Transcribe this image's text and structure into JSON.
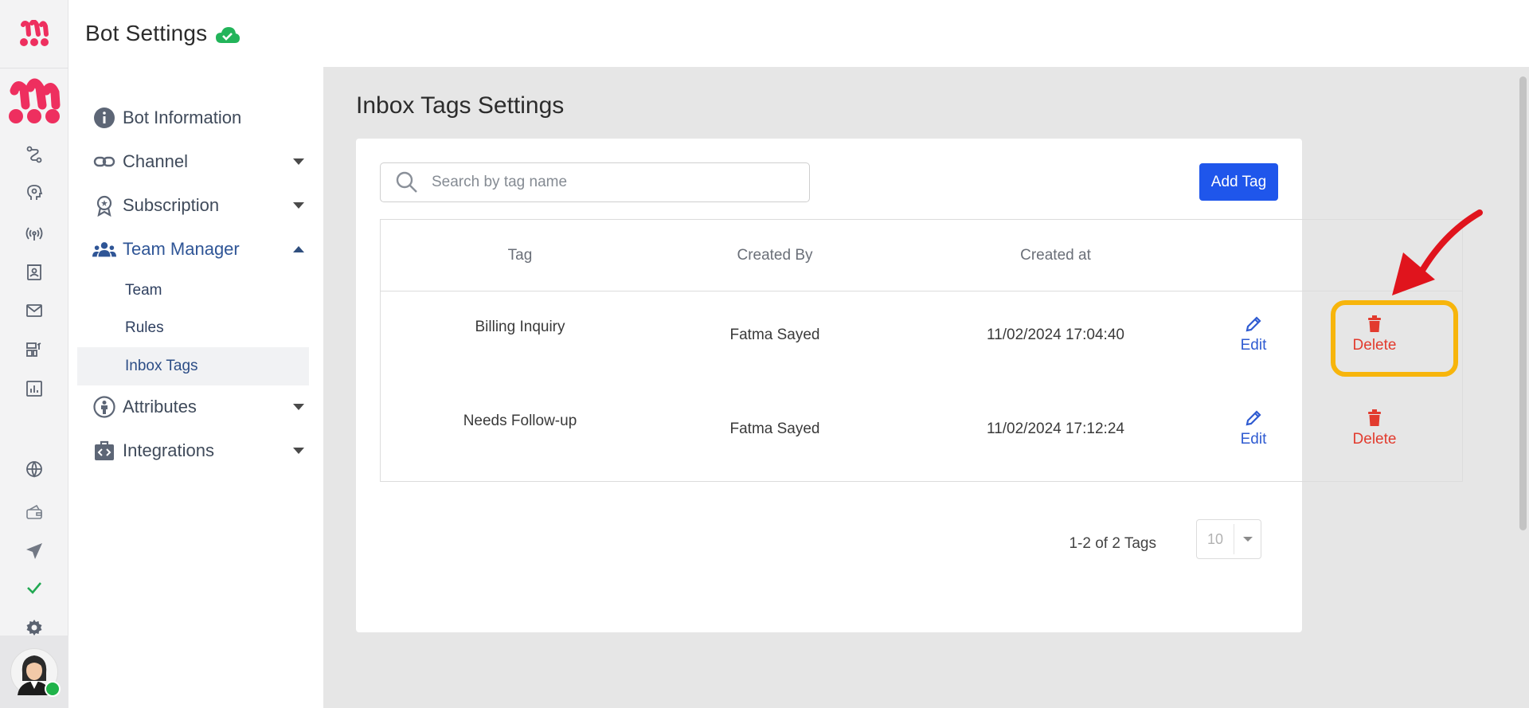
{
  "app": {
    "brand_color": "#ee2f5f",
    "accent": "#1f56eb"
  },
  "header": {
    "title": "Bot Settings",
    "status_icon": "cloud-check-icon"
  },
  "rail": {
    "icons": [
      "flow-icon",
      "ai-brain-icon",
      "broadcast-icon",
      "contacts-icon",
      "mail-icon",
      "widgets-icon",
      "analytics-icon",
      "globe-icon",
      "wallet-icon",
      "send-icon",
      "check-icon",
      "gear-icon"
    ]
  },
  "settings_nav": {
    "items": [
      {
        "label": "Bot Information",
        "icon": "info-icon"
      },
      {
        "label": "Channel",
        "icon": "link-icon"
      },
      {
        "label": "Subscription",
        "icon": "badge-icon"
      },
      {
        "label": "Team Manager",
        "icon": "team-icon"
      },
      {
        "label": "Attributes",
        "icon": "person-icon"
      },
      {
        "label": "Integrations",
        "icon": "code-bag-icon"
      }
    ],
    "team_sub": [
      {
        "label": "Team"
      },
      {
        "label": "Rules"
      },
      {
        "label": "Inbox Tags"
      }
    ]
  },
  "main": {
    "heading": "Inbox Tags Settings",
    "search": {
      "placeholder": "Search by tag name",
      "value": ""
    },
    "add_label": "Add Tag",
    "columns": [
      "Tag",
      "Created By",
      "Created at"
    ],
    "rows": [
      {
        "tag": "Billing Inquiry",
        "created_by": "Fatma Sayed",
        "created_at": "11/02/2024 17:04:40",
        "edit": "Edit",
        "delete": "Delete"
      },
      {
        "tag": "Needs Follow-up",
        "created_by": "Fatma Sayed",
        "created_at": "11/02/2024 17:12:24",
        "edit": "Edit",
        "delete": "Delete"
      }
    ],
    "pagination": {
      "summary": "1-2 of 2 Tags",
      "page_size": "10"
    }
  }
}
